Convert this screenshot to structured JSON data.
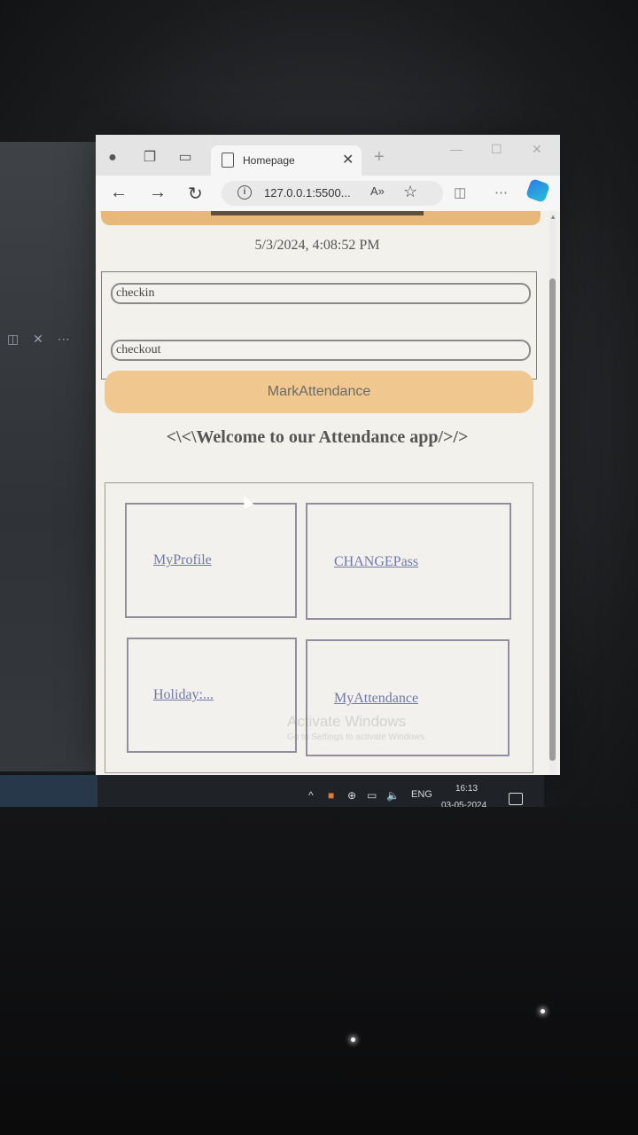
{
  "desktop": {
    "left_icons": "◫ ✕ ⋯",
    "taskbar": {
      "lang": "ENG",
      "time": "16:13",
      "date": "03-05-2024"
    }
  },
  "browser": {
    "tab": {
      "title": "Homepage"
    },
    "address": {
      "url": "127.0.0.1:5500...",
      "read_aloud": "A»"
    }
  },
  "page": {
    "datetime": "5/3/2024, 4:08:52 PM",
    "fields": [
      {
        "value": "checkin"
      },
      {
        "value": "checkout"
      }
    ],
    "mark_button": "MarkAttendance",
    "welcome": "<\\<\\Welcome to our Attendance app/>/>",
    "links": [
      {
        "label": "MyProfile"
      },
      {
        "label": "CHANGEPass"
      },
      {
        "label": "Holiday:..."
      },
      {
        "label": "MyAttendance"
      }
    ],
    "watermark": {
      "title": "Activate Windows",
      "subtitle": "Go to Settings to activate Windows."
    }
  },
  "colors": {
    "header_strip": "#e8b77a",
    "mark_button": "#f0c78e",
    "link": "#6f78a8"
  }
}
